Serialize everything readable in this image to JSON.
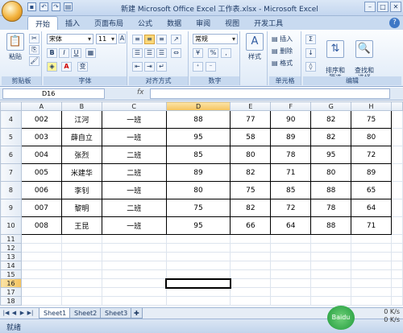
{
  "window": {
    "title": "新建 Microsoft Office Excel 工作表.xlsx - Microsoft Excel"
  },
  "quick_access": [
    "save",
    "undo",
    "redo",
    "print"
  ],
  "tabs": [
    "开始",
    "插入",
    "页面布局",
    "公式",
    "数据",
    "审阅",
    "视图",
    "开发工具"
  ],
  "ribbon": {
    "clipboard": {
      "paste": "粘贴",
      "label": "剪贴板"
    },
    "font": {
      "name": "宋体",
      "size": "11",
      "label": "字体",
      "bold": "B",
      "italic": "I",
      "underline": "U",
      "font_color": "A",
      "grow": "A",
      "shrink": "A",
      "phonetic": "变"
    },
    "alignment": {
      "label": "对齐方式"
    },
    "number": {
      "format": "常规",
      "label": "数字",
      "percent": "%",
      "comma": ","
    },
    "styles": {
      "label": "样式"
    },
    "cells": {
      "insert": "插入",
      "delete": "删除",
      "format": "格式",
      "label": "单元格"
    },
    "editing": {
      "sum": "Σ",
      "sort": "排序和\n筛选",
      "find": "查找和\n选择",
      "label": "编辑"
    }
  },
  "formula_bar": {
    "name_box": "D16",
    "fx": "fx",
    "value": ""
  },
  "columns": [
    "A",
    "B",
    "C",
    "D",
    "E",
    "F",
    "G",
    "H"
  ],
  "selected_column": "D",
  "selected_row": "16",
  "rows": [
    {
      "num": "4",
      "cells": [
        "002",
        "江河",
        "一班",
        "88",
        "77",
        "90",
        "82",
        "75"
      ]
    },
    {
      "num": "5",
      "cells": [
        "003",
        "薛自立",
        "一班",
        "95",
        "58",
        "89",
        "82",
        "80"
      ]
    },
    {
      "num": "6",
      "cells": [
        "004",
        "张烈",
        "二班",
        "85",
        "80",
        "78",
        "95",
        "72"
      ]
    },
    {
      "num": "7",
      "cells": [
        "005",
        "米建华",
        "二班",
        "89",
        "82",
        "71",
        "80",
        "89"
      ]
    },
    {
      "num": "8",
      "cells": [
        "006",
        "李钊",
        "一班",
        "80",
        "75",
        "85",
        "88",
        "65"
      ]
    },
    {
      "num": "9",
      "cells": [
        "007",
        "黎明",
        "二班",
        "75",
        "82",
        "72",
        "78",
        "64"
      ]
    },
    {
      "num": "10",
      "cells": [
        "008",
        "王昆",
        "一班",
        "95",
        "66",
        "64",
        "88",
        "71"
      ]
    }
  ],
  "empty_rows": [
    "11",
    "12",
    "13",
    "14",
    "15",
    "16",
    "17",
    "18"
  ],
  "sheets": [
    "Sheet1",
    "Sheet2",
    "Sheet3"
  ],
  "active_sheet": "Sheet1",
  "status": {
    "text": "就绪"
  },
  "speed": {
    "up": "0 K/s",
    "down": "0 K/s"
  },
  "watermark": "Baidu"
}
